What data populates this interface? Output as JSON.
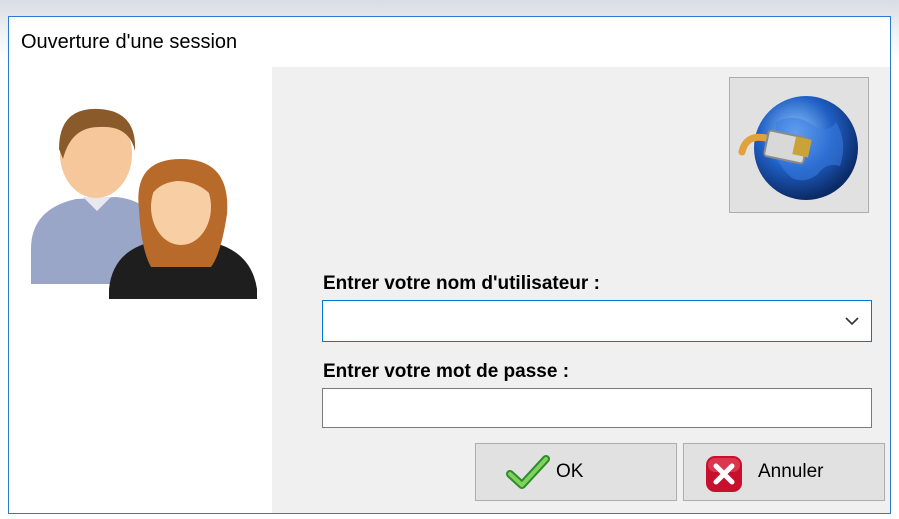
{
  "window": {
    "title": "Ouverture d'une session"
  },
  "left_panel": {
    "icon": "users-icon"
  },
  "globe_button": {
    "icon": "network-globe-icon"
  },
  "form": {
    "username_label": "Entrer votre nom d'utilisateur :",
    "username_value": "",
    "username_placeholder": "",
    "password_label": "Entrer votre mot de passe :",
    "password_value": "",
    "password_placeholder": ""
  },
  "buttons": {
    "ok_label": "OK",
    "ok_icon": "check-icon",
    "cancel_label": "Annuler",
    "cancel_icon": "red-x-icon"
  },
  "colors": {
    "accent": "#0078d7",
    "window_border": "#2b7bd6",
    "button_face": "#e1e1e1"
  }
}
